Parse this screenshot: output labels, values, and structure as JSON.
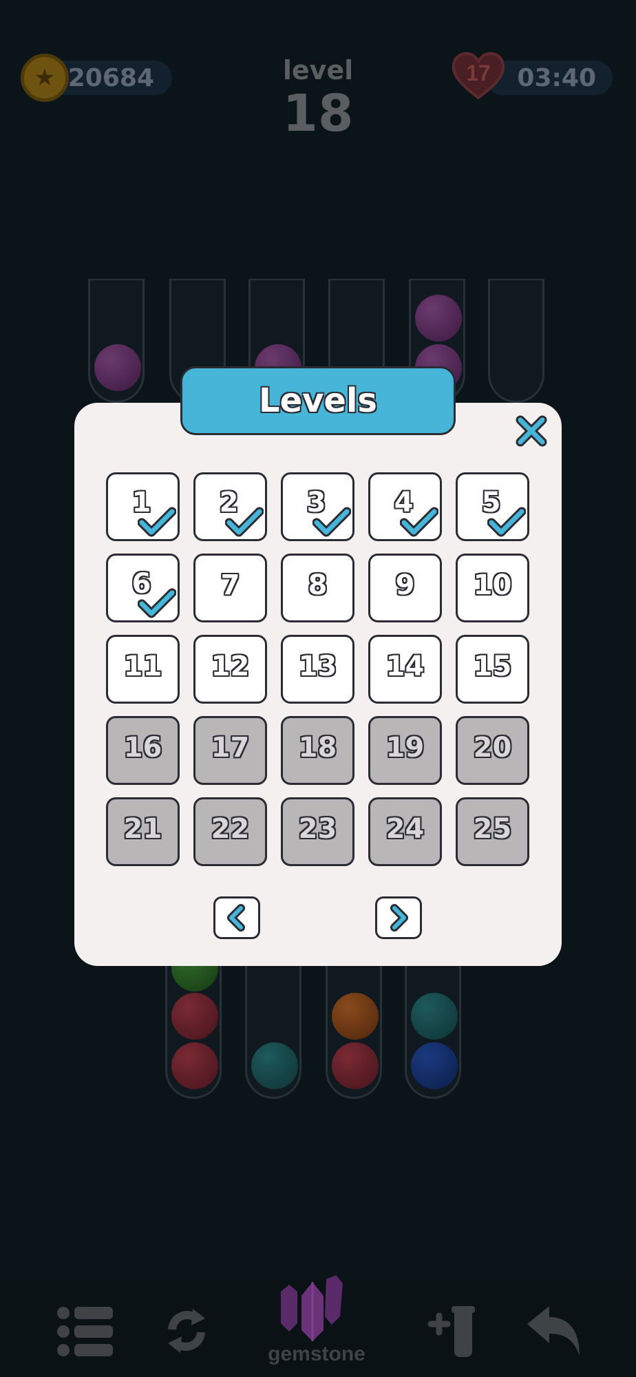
{
  "hud": {
    "coins": "20684",
    "lives": "17",
    "timer": "03:40",
    "level_label": "level",
    "level_number": "18"
  },
  "modal": {
    "title": "Levels",
    "levels": [
      {
        "n": "1",
        "state": "completed"
      },
      {
        "n": "2",
        "state": "completed"
      },
      {
        "n": "3",
        "state": "completed"
      },
      {
        "n": "4",
        "state": "completed"
      },
      {
        "n": "5",
        "state": "completed"
      },
      {
        "n": "6",
        "state": "completed"
      },
      {
        "n": "7",
        "state": "unlocked"
      },
      {
        "n": "8",
        "state": "unlocked"
      },
      {
        "n": "9",
        "state": "unlocked"
      },
      {
        "n": "10",
        "state": "unlocked"
      },
      {
        "n": "11",
        "state": "unlocked"
      },
      {
        "n": "12",
        "state": "unlocked"
      },
      {
        "n": "13",
        "state": "unlocked"
      },
      {
        "n": "14",
        "state": "unlocked"
      },
      {
        "n": "15",
        "state": "unlocked"
      },
      {
        "n": "16",
        "state": "locked"
      },
      {
        "n": "17",
        "state": "locked"
      },
      {
        "n": "18",
        "state": "locked"
      },
      {
        "n": "19",
        "state": "locked"
      },
      {
        "n": "20",
        "state": "locked"
      },
      {
        "n": "21",
        "state": "locked"
      },
      {
        "n": "22",
        "state": "locked"
      },
      {
        "n": "23",
        "state": "locked"
      },
      {
        "n": "24",
        "state": "locked"
      },
      {
        "n": "25",
        "state": "locked"
      }
    ]
  },
  "toolbar": {
    "gem_label": "gemstone"
  },
  "colors": {
    "accent": "#46b5d8",
    "outline": "#2a2b33",
    "modal_bg": "#f4f0f0",
    "locked_bg": "#b8b6b6"
  }
}
